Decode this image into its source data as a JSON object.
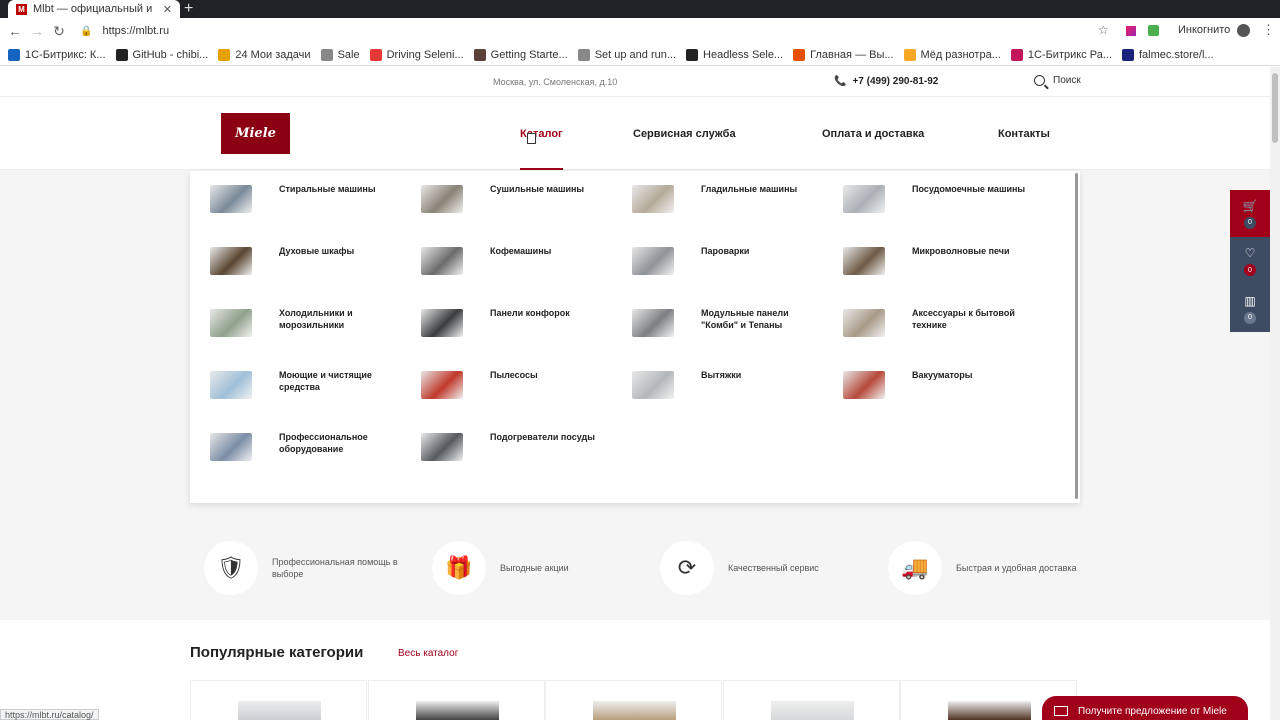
{
  "browser": {
    "tab_title": "Mlbt — официальный и",
    "tab_close": "✕",
    "new_tab": "+",
    "favicon_letter": "M",
    "url": "https://mlbt.ru",
    "incognito_label": "Инкогнито",
    "status_url": "https://mlbt.ru/catalog/",
    "bookmarks": [
      {
        "label": "1С-Битрикс: К...",
        "color": "#1565c0",
        "icon": "bitrix-icon"
      },
      {
        "label": "GitHub - chibi...",
        "color": "#222222",
        "icon": "github-icon"
      },
      {
        "label": "24  Мои задачи",
        "color": "#e6a000",
        "icon": "tasks-icon"
      },
      {
        "label": "Sale",
        "color": "#888888",
        "icon": "page-icon"
      },
      {
        "label": "Driving Seleni...",
        "color": "#e53935",
        "icon": "youtube-icon"
      },
      {
        "label": "Getting Starte...",
        "color": "#5d4037",
        "icon": "docs-icon"
      },
      {
        "label": "Set up and run...",
        "color": "#888888",
        "icon": "page-icon"
      },
      {
        "label": "Headless Sele...",
        "color": "#222222",
        "icon": "github-icon"
      },
      {
        "label": "Главная — Вы...",
        "color": "#e65100",
        "icon": "site-icon"
      },
      {
        "label": "Мёд разнотра...",
        "color": "#f9a825",
        "icon": "honey-icon"
      },
      {
        "label": "1С-Битрикс Ра...",
        "color": "#c2185b",
        "icon": "bitrix-icon"
      },
      {
        "label": "falmec.store/l...",
        "color": "#1a237e",
        "icon": "n-icon"
      }
    ]
  },
  "site": {
    "address": "Москва, ул. Смоленская, д.10",
    "phone": "+7 (499) 290-81-92",
    "search_label": "Поиск",
    "logo_text": "Miele",
    "nav": [
      "Каталог",
      "Сервисная служба",
      "Оплата и доставка",
      "Контакты"
    ]
  },
  "catalog": [
    {
      "label": "Стиральные машины",
      "color": "#7a8a99"
    },
    {
      "label": "Сушильные машины",
      "color": "#8a8275"
    },
    {
      "label": "Гладильные машины",
      "color": "#b5aa99"
    },
    {
      "label": "Посудомоечные машины",
      "color": "#aab0b5"
    },
    {
      "label": "Духовые шкафы",
      "color": "#5a4632"
    },
    {
      "label": "Кофемашины",
      "color": "#6b6b6b"
    },
    {
      "label": "Пароварки",
      "color": "#8f9296"
    },
    {
      "label": "Микроволновые печи",
      "color": "#6e5a46"
    },
    {
      "label": "Холодильники и морозильники",
      "color": "#8fa08a"
    },
    {
      "label": "Панели конфорок",
      "color": "#3a3c3e"
    },
    {
      "label": "Модульные панели \"Комби\" и Тепаны",
      "color": "#7d7f82"
    },
    {
      "label": "Аксессуары к бытовой технике",
      "color": "#a89a88"
    },
    {
      "label": "Моющие и чистящие средства",
      "color": "#9fbfd8"
    },
    {
      "label": "Пылесосы",
      "color": "#c0392b"
    },
    {
      "label": "Вытяжки",
      "color": "#b4b7ba"
    },
    {
      "label": "Вакууматоры",
      "color": "#b64a3c"
    },
    {
      "label": "Профессиональное оборудование",
      "color": "#7b8da6"
    },
    {
      "label": "Подогреватели посуды",
      "color": "#555a5e"
    }
  ],
  "features": [
    {
      "icon": "shield-check-icon",
      "glyph": "🛡",
      "text": "Профессиональная помощь в выборе"
    },
    {
      "icon": "gift-icon",
      "glyph": "🎁",
      "text": "Выгодные акции"
    },
    {
      "icon": "service-icon",
      "glyph": "⟳",
      "text": "Качественный сервис"
    },
    {
      "icon": "truck-icon",
      "glyph": "🚚",
      "text": "Быстрая и удобная доставка"
    }
  ],
  "popular": {
    "title": "Популярные категории",
    "all_link": "Весь каталог"
  },
  "sidebar": {
    "cart_count": "0",
    "favorites_count": "0",
    "compare_count": "0"
  },
  "offer_label": "Получите предложение от Miele",
  "colors": {
    "brand": "#8c0014",
    "accent": "#a0001a",
    "side_blue": "#3d4b63"
  }
}
